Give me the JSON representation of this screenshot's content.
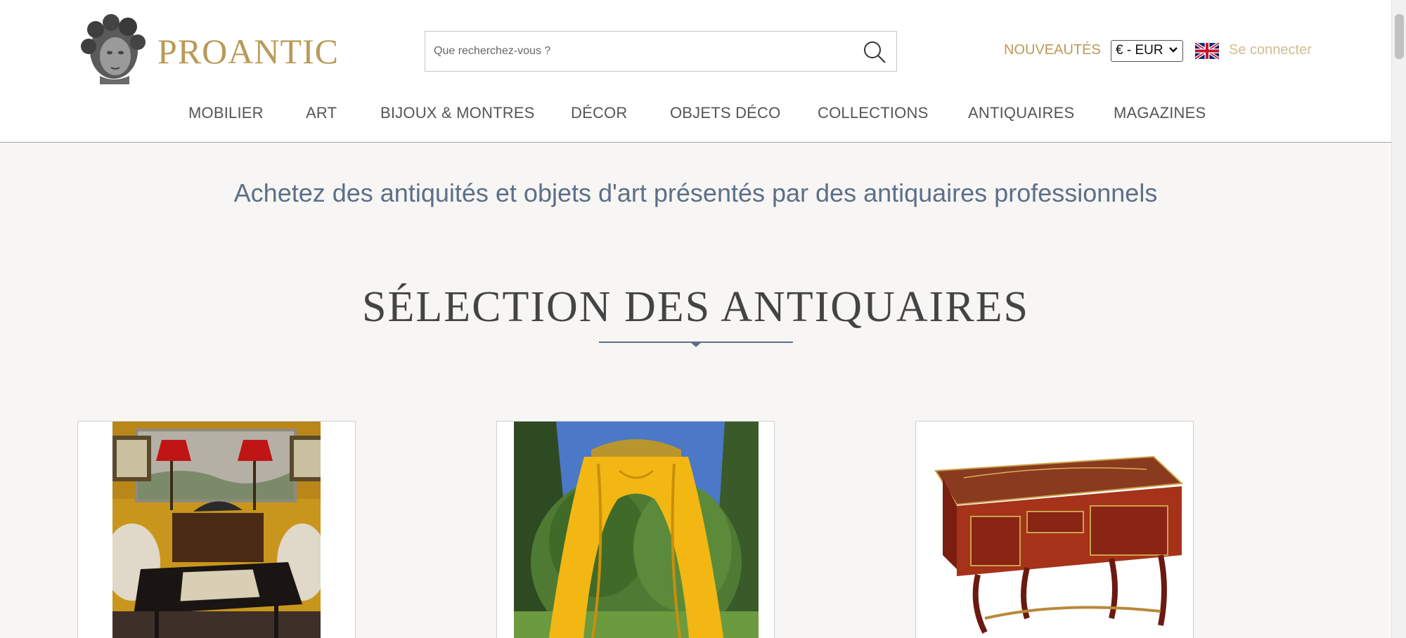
{
  "header": {
    "brand": "PROANTIC",
    "search": {
      "placeholder": "Que recherchez-vous ?"
    },
    "nouveautes": "NOUVEAUTÉS",
    "currency": "€ - EUR",
    "login": "Se connecter",
    "icons": [
      "search-icon",
      "uk-flag-icon",
      "chevron-down-icon"
    ]
  },
  "nav": {
    "items": [
      "MOBILIER",
      "ART",
      "BIJOUX & MONTRES",
      "DÉCOR",
      "OBJETS DÉCO",
      "COLLECTIONS",
      "ANTIQUAIRES",
      "MAGAZINES"
    ]
  },
  "main": {
    "tagline": "Achetez des antiquités et objets d'art présentés par des antiquaires professionnels",
    "section_title": "SÉLECTION DES ANTIQUAIRES"
  },
  "colors": {
    "brand_gold": "#b99a57",
    "accent_blue": "#5d6f88",
    "background": "#f7f6f4"
  }
}
